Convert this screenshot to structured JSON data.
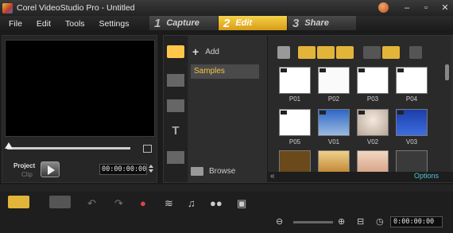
{
  "window": {
    "title": "Corel VideoStudio Pro - Untitled",
    "controls": [
      "–",
      "▫",
      "✕"
    ]
  },
  "menu": [
    "File",
    "Edit",
    "Tools",
    "Settings"
  ],
  "steps": [
    {
      "num": "1",
      "label": "Capture"
    },
    {
      "num": "2",
      "label": "Edit"
    },
    {
      "num": "3",
      "label": "Share"
    }
  ],
  "preview": {
    "mode_project": "Project",
    "mode_clip": "Clip",
    "timecode": "00:00:00:00"
  },
  "library": {
    "add_label": "Add",
    "selected_folder": "Samples",
    "browse_label": "Browse",
    "options_label": "Options",
    "thumbnails": [
      {
        "label": "P01",
        "type": "photo"
      },
      {
        "label": "P02",
        "type": "photo"
      },
      {
        "label": "P03",
        "type": "photo"
      },
      {
        "label": "P04",
        "type": "photo"
      },
      {
        "label": "P05",
        "type": "photo"
      },
      {
        "label": "V01",
        "type": "video"
      },
      {
        "label": "V02",
        "type": "video"
      },
      {
        "label": "V03",
        "type": "video"
      }
    ]
  },
  "timeline": {
    "timecode": "0:00:00:00"
  },
  "colors": {
    "accent": "#f5c24a",
    "options_text": "#54c6d4"
  }
}
